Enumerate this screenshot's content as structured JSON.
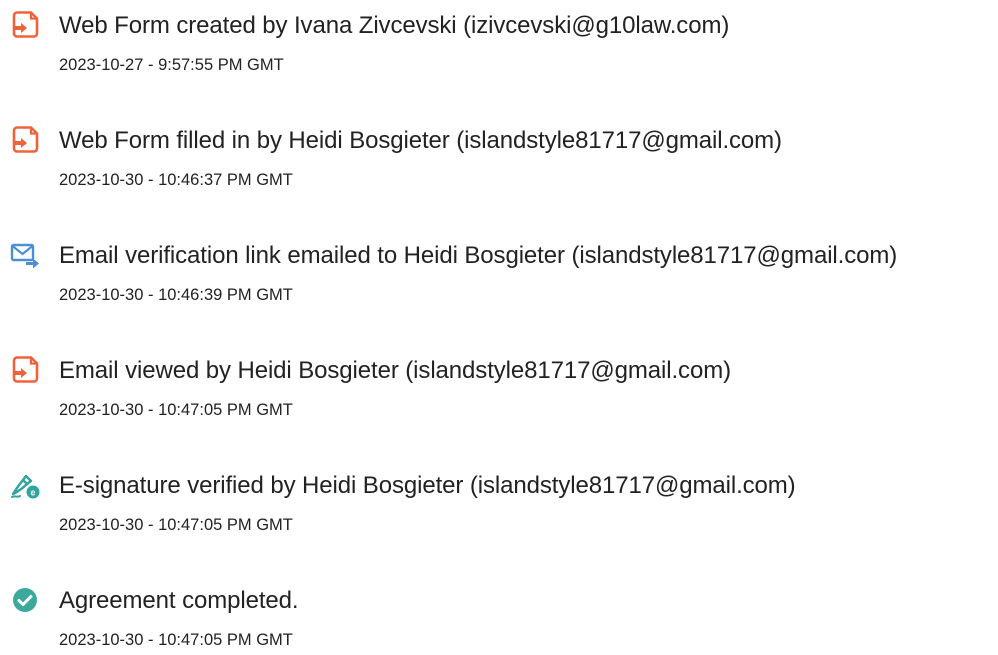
{
  "audit_trail": {
    "events": [
      {
        "icon": "web-form-icon",
        "title": "Web Form created by Ivana Zivcevski (izivcevski@g10law.com)",
        "timestamp": "2023-10-27 - 9:57:55 PM GMT"
      },
      {
        "icon": "web-form-icon",
        "title": "Web Form filled in by Heidi Bosgieter (islandstyle81717@gmail.com)",
        "timestamp": "2023-10-30 - 10:46:37 PM GMT"
      },
      {
        "icon": "email-send-icon",
        "title": "Email verification link emailed to Heidi Bosgieter (islandstyle81717@gmail.com)",
        "timestamp": "2023-10-30 - 10:46:39 PM GMT"
      },
      {
        "icon": "web-form-icon",
        "title": "Email viewed by Heidi Bosgieter (islandstyle81717@gmail.com)",
        "timestamp": "2023-10-30 - 10:47:05 PM GMT"
      },
      {
        "icon": "e-signature-icon",
        "title": "E-signature verified by Heidi Bosgieter (islandstyle81717@gmail.com)",
        "timestamp": "2023-10-30 - 10:47:05 PM GMT"
      },
      {
        "icon": "check-circle-icon",
        "title": "Agreement completed.",
        "timestamp": "2023-10-30 - 10:47:05 PM GMT"
      }
    ]
  },
  "colors": {
    "document_icon": "#f0633a",
    "email_icon": "#4a90d9",
    "signature_icon": "#2fa59b",
    "check_icon": "#3ca99a",
    "text": "#222222"
  }
}
